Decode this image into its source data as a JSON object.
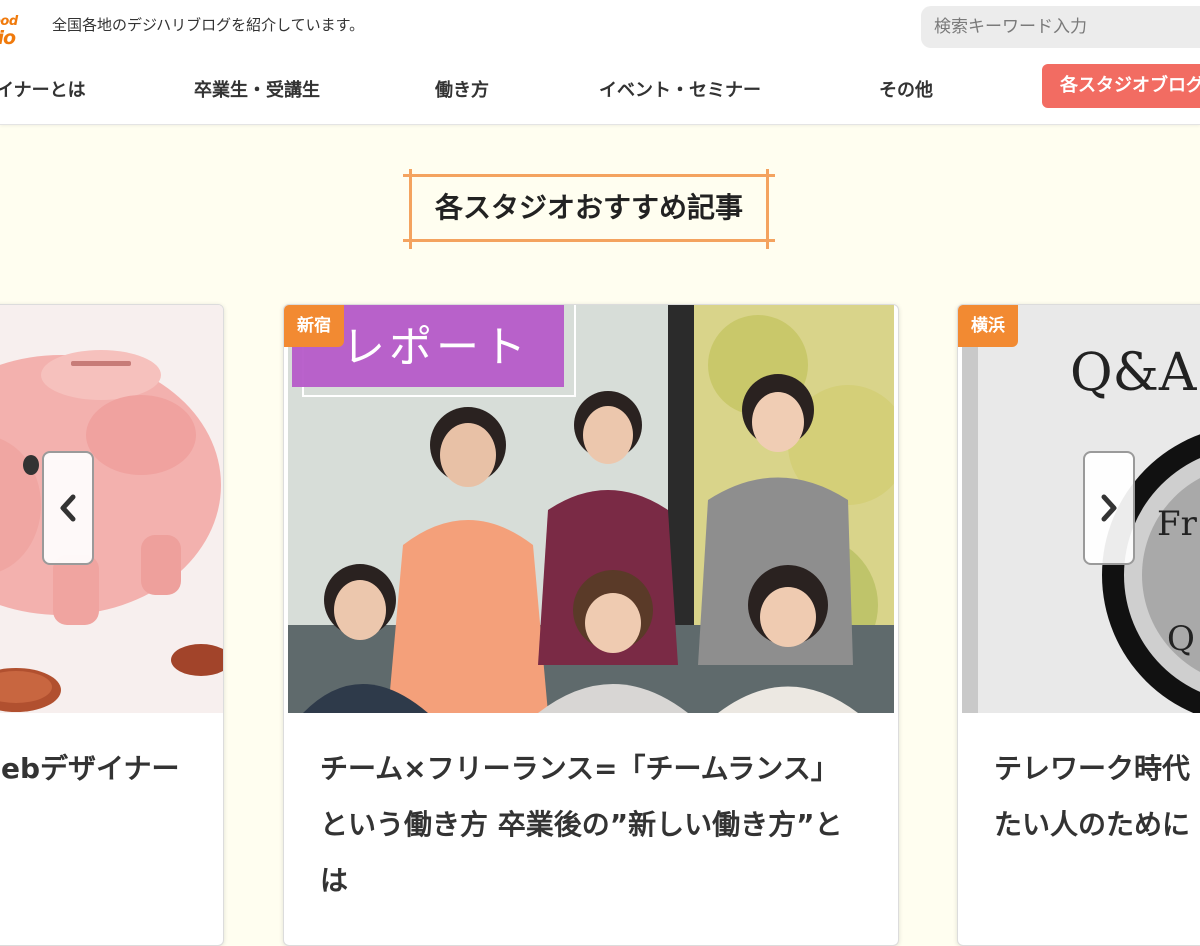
{
  "header": {
    "logo_line1": "ood",
    "logo_line2": "lio",
    "tagline": "全国各地のデジハリブログを紹介しています。",
    "search_placeholder": "検索キーワード入力"
  },
  "nav": {
    "items": [
      "イナーとは",
      "卒業生・受講生",
      "働き方",
      "イベント・セミナー",
      "その他"
    ],
    "cta_label": "各スタジオブログ"
  },
  "section": {
    "title": "各スタジオおすすめ記事"
  },
  "cards": [
    {
      "title_lines": [
        "ebデザイナー"
      ]
    },
    {
      "tag": "新宿",
      "image_label": "レポート",
      "title_lines": [
        "チーム×フリーランス=「チームランス」",
        "という働き方 卒業後の”新しい働き方”と",
        "は"
      ]
    },
    {
      "tag": "横浜",
      "image_label": "Q&A",
      "title_lines": [
        "テレワーク時代",
        "たい人のために"
      ]
    }
  ],
  "carousel": {
    "prev_icon": "chevron-left-icon",
    "next_icon": "chevron-right-icon"
  },
  "colors": {
    "accent": "#f26c62",
    "tag": "#f28a32",
    "title_border": "#f4a35f",
    "report_overlay": "#b65ac9",
    "background": "#fffef0"
  }
}
